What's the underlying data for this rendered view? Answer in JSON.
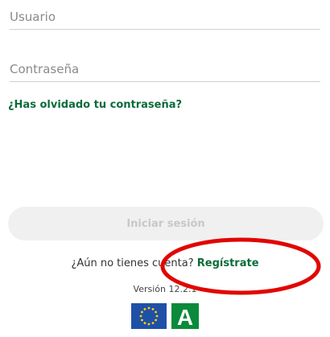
{
  "login_form": {
    "username_placeholder": "Usuario",
    "password_placeholder": "Contraseña",
    "forgot_password_link": "¿Has olvidado tu contraseña?",
    "login_button": "Iniciar sesión"
  },
  "signup": {
    "prompt": "¿Aún no tienes cuenta?",
    "link": "Regístrate"
  },
  "version_text": "Versión 12.2.1",
  "footer": {
    "logo_1": "eu-flag-icon",
    "logo_2": "junta-andalucia-logo",
    "logo_2_text": "A"
  },
  "annotation": {
    "highlight": "red-circle-annotation",
    "color": "#e10600"
  },
  "colors": {
    "brand_green": "#0b6b3a",
    "eu_blue": "#1f50a8",
    "eu_star": "#ffd200",
    "andalucia_green": "#0a8a3a",
    "disabled_button_bg": "#f0f0f0",
    "disabled_button_text": "#c8c8c8"
  }
}
